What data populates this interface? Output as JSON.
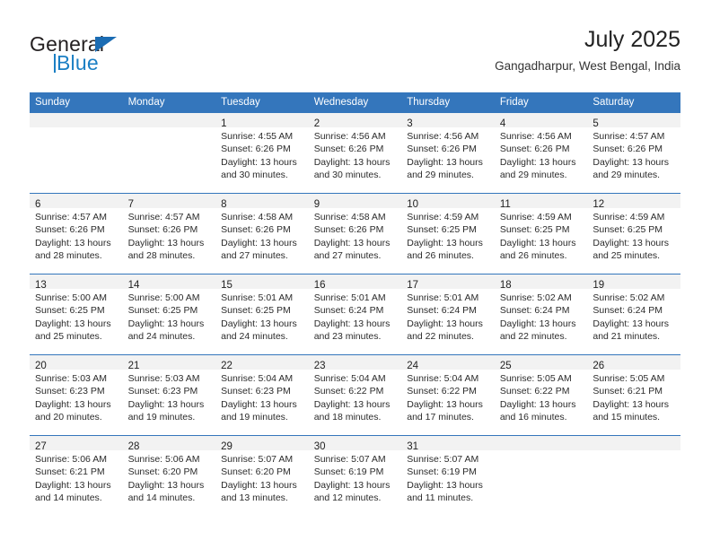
{
  "brand": {
    "word_top": "General",
    "word_bottom": "Blue",
    "accent_color": "#1b7fc4"
  },
  "header": {
    "title": "July 2025",
    "subtitle": "Gangadharpur, West Bengal, India"
  },
  "theme": {
    "header_blue": "#3476BC",
    "daynum_band": "#f2f2f2",
    "text": "#222222"
  },
  "calendar": {
    "weekday_headers": [
      "Sunday",
      "Monday",
      "Tuesday",
      "Wednesday",
      "Thursday",
      "Friday",
      "Saturday"
    ],
    "weeks": [
      [
        {
          "day": "",
          "sunrise": "",
          "sunset": "",
          "daylight_1": "",
          "daylight_2": ""
        },
        {
          "day": "",
          "sunrise": "",
          "sunset": "",
          "daylight_1": "",
          "daylight_2": ""
        },
        {
          "day": "1",
          "sunrise": "Sunrise: 4:55 AM",
          "sunset": "Sunset: 6:26 PM",
          "daylight_1": "Daylight: 13 hours",
          "daylight_2": "and 30 minutes."
        },
        {
          "day": "2",
          "sunrise": "Sunrise: 4:56 AM",
          "sunset": "Sunset: 6:26 PM",
          "daylight_1": "Daylight: 13 hours",
          "daylight_2": "and 30 minutes."
        },
        {
          "day": "3",
          "sunrise": "Sunrise: 4:56 AM",
          "sunset": "Sunset: 6:26 PM",
          "daylight_1": "Daylight: 13 hours",
          "daylight_2": "and 29 minutes."
        },
        {
          "day": "4",
          "sunrise": "Sunrise: 4:56 AM",
          "sunset": "Sunset: 6:26 PM",
          "daylight_1": "Daylight: 13 hours",
          "daylight_2": "and 29 minutes."
        },
        {
          "day": "5",
          "sunrise": "Sunrise: 4:57 AM",
          "sunset": "Sunset: 6:26 PM",
          "daylight_1": "Daylight: 13 hours",
          "daylight_2": "and 29 minutes."
        }
      ],
      [
        {
          "day": "6",
          "sunrise": "Sunrise: 4:57 AM",
          "sunset": "Sunset: 6:26 PM",
          "daylight_1": "Daylight: 13 hours",
          "daylight_2": "and 28 minutes."
        },
        {
          "day": "7",
          "sunrise": "Sunrise: 4:57 AM",
          "sunset": "Sunset: 6:26 PM",
          "daylight_1": "Daylight: 13 hours",
          "daylight_2": "and 28 minutes."
        },
        {
          "day": "8",
          "sunrise": "Sunrise: 4:58 AM",
          "sunset": "Sunset: 6:26 PM",
          "daylight_1": "Daylight: 13 hours",
          "daylight_2": "and 27 minutes."
        },
        {
          "day": "9",
          "sunrise": "Sunrise: 4:58 AM",
          "sunset": "Sunset: 6:26 PM",
          "daylight_1": "Daylight: 13 hours",
          "daylight_2": "and 27 minutes."
        },
        {
          "day": "10",
          "sunrise": "Sunrise: 4:59 AM",
          "sunset": "Sunset: 6:25 PM",
          "daylight_1": "Daylight: 13 hours",
          "daylight_2": "and 26 minutes."
        },
        {
          "day": "11",
          "sunrise": "Sunrise: 4:59 AM",
          "sunset": "Sunset: 6:25 PM",
          "daylight_1": "Daylight: 13 hours",
          "daylight_2": "and 26 minutes."
        },
        {
          "day": "12",
          "sunrise": "Sunrise: 4:59 AM",
          "sunset": "Sunset: 6:25 PM",
          "daylight_1": "Daylight: 13 hours",
          "daylight_2": "and 25 minutes."
        }
      ],
      [
        {
          "day": "13",
          "sunrise": "Sunrise: 5:00 AM",
          "sunset": "Sunset: 6:25 PM",
          "daylight_1": "Daylight: 13 hours",
          "daylight_2": "and 25 minutes."
        },
        {
          "day": "14",
          "sunrise": "Sunrise: 5:00 AM",
          "sunset": "Sunset: 6:25 PM",
          "daylight_1": "Daylight: 13 hours",
          "daylight_2": "and 24 minutes."
        },
        {
          "day": "15",
          "sunrise": "Sunrise: 5:01 AM",
          "sunset": "Sunset: 6:25 PM",
          "daylight_1": "Daylight: 13 hours",
          "daylight_2": "and 24 minutes."
        },
        {
          "day": "16",
          "sunrise": "Sunrise: 5:01 AM",
          "sunset": "Sunset: 6:24 PM",
          "daylight_1": "Daylight: 13 hours",
          "daylight_2": "and 23 minutes."
        },
        {
          "day": "17",
          "sunrise": "Sunrise: 5:01 AM",
          "sunset": "Sunset: 6:24 PM",
          "daylight_1": "Daylight: 13 hours",
          "daylight_2": "and 22 minutes."
        },
        {
          "day": "18",
          "sunrise": "Sunrise: 5:02 AM",
          "sunset": "Sunset: 6:24 PM",
          "daylight_1": "Daylight: 13 hours",
          "daylight_2": "and 22 minutes."
        },
        {
          "day": "19",
          "sunrise": "Sunrise: 5:02 AM",
          "sunset": "Sunset: 6:24 PM",
          "daylight_1": "Daylight: 13 hours",
          "daylight_2": "and 21 minutes."
        }
      ],
      [
        {
          "day": "20",
          "sunrise": "Sunrise: 5:03 AM",
          "sunset": "Sunset: 6:23 PM",
          "daylight_1": "Daylight: 13 hours",
          "daylight_2": "and 20 minutes."
        },
        {
          "day": "21",
          "sunrise": "Sunrise: 5:03 AM",
          "sunset": "Sunset: 6:23 PM",
          "daylight_1": "Daylight: 13 hours",
          "daylight_2": "and 19 minutes."
        },
        {
          "day": "22",
          "sunrise": "Sunrise: 5:04 AM",
          "sunset": "Sunset: 6:23 PM",
          "daylight_1": "Daylight: 13 hours",
          "daylight_2": "and 19 minutes."
        },
        {
          "day": "23",
          "sunrise": "Sunrise: 5:04 AM",
          "sunset": "Sunset: 6:22 PM",
          "daylight_1": "Daylight: 13 hours",
          "daylight_2": "and 18 minutes."
        },
        {
          "day": "24",
          "sunrise": "Sunrise: 5:04 AM",
          "sunset": "Sunset: 6:22 PM",
          "daylight_1": "Daylight: 13 hours",
          "daylight_2": "and 17 minutes."
        },
        {
          "day": "25",
          "sunrise": "Sunrise: 5:05 AM",
          "sunset": "Sunset: 6:22 PM",
          "daylight_1": "Daylight: 13 hours",
          "daylight_2": "and 16 minutes."
        },
        {
          "day": "26",
          "sunrise": "Sunrise: 5:05 AM",
          "sunset": "Sunset: 6:21 PM",
          "daylight_1": "Daylight: 13 hours",
          "daylight_2": "and 15 minutes."
        }
      ],
      [
        {
          "day": "27",
          "sunrise": "Sunrise: 5:06 AM",
          "sunset": "Sunset: 6:21 PM",
          "daylight_1": "Daylight: 13 hours",
          "daylight_2": "and 14 minutes."
        },
        {
          "day": "28",
          "sunrise": "Sunrise: 5:06 AM",
          "sunset": "Sunset: 6:20 PM",
          "daylight_1": "Daylight: 13 hours",
          "daylight_2": "and 14 minutes."
        },
        {
          "day": "29",
          "sunrise": "Sunrise: 5:07 AM",
          "sunset": "Sunset: 6:20 PM",
          "daylight_1": "Daylight: 13 hours",
          "daylight_2": "and 13 minutes."
        },
        {
          "day": "30",
          "sunrise": "Sunrise: 5:07 AM",
          "sunset": "Sunset: 6:19 PM",
          "daylight_1": "Daylight: 13 hours",
          "daylight_2": "and 12 minutes."
        },
        {
          "day": "31",
          "sunrise": "Sunrise: 5:07 AM",
          "sunset": "Sunset: 6:19 PM",
          "daylight_1": "Daylight: 13 hours",
          "daylight_2": "and 11 minutes."
        },
        {
          "day": "",
          "sunrise": "",
          "sunset": "",
          "daylight_1": "",
          "daylight_2": ""
        },
        {
          "day": "",
          "sunrise": "",
          "sunset": "",
          "daylight_1": "",
          "daylight_2": ""
        }
      ]
    ]
  }
}
